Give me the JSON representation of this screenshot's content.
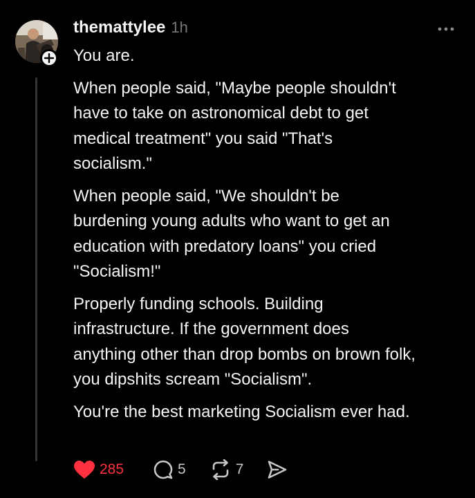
{
  "post": {
    "username": "themattylee",
    "timestamp": "1h",
    "paragraphs": [
      "You are.",
      "When people said, \"Maybe people shouldn't\nhave to take on astronomical debt to get\nmedical treatment\" you said \"That's\nsocialism.\"",
      "When people said, \"We shouldn't be\nburdening young adults who want to get an\neducation with predatory loans\" you cried\n\"Socialism!\"",
      "Properly funding schools. Building\ninfrastructure. If the government does\nanything other than drop bombs on brown folk,\nyou dipshits scream \"Socialism\".",
      "You're the best marketing Socialism ever had."
    ],
    "likes": "285",
    "replies": "5",
    "reposts": "7",
    "liked": true
  },
  "colors": {
    "background": "#000000",
    "text": "#f3f5f7",
    "muted": "#777777",
    "like": "#ff3040",
    "thread_line": "#333638"
  },
  "icons": {
    "more": "more-horizontal-icon",
    "follow": "plus-icon",
    "like": "heart-filled-icon",
    "reply": "comment-bubble-icon",
    "repost": "repost-icon",
    "share": "send-icon"
  }
}
